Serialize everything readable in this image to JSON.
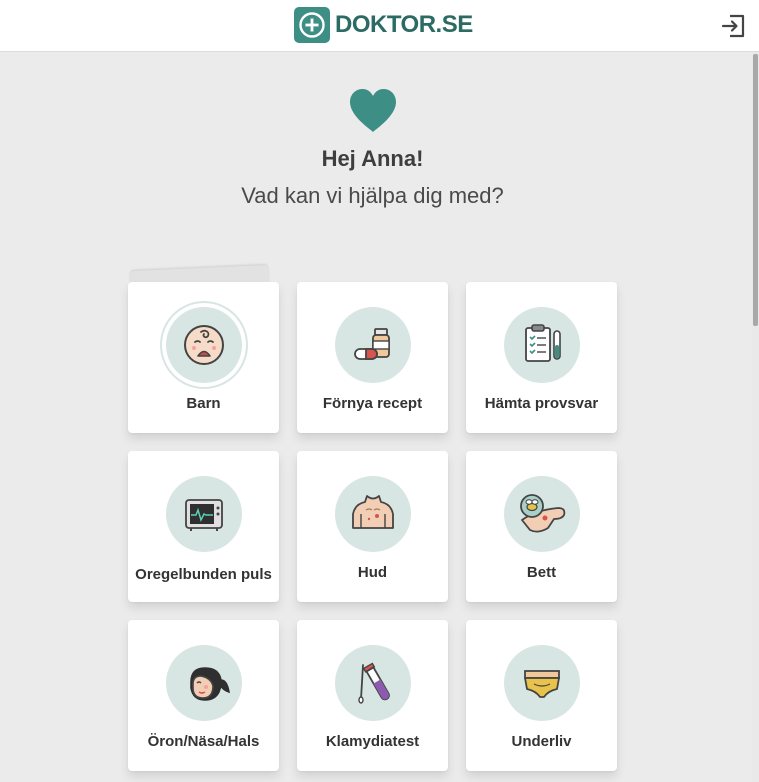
{
  "header": {
    "brand": "DOKTOR.SE",
    "logout_icon": "logout-icon"
  },
  "welcome": {
    "icon": "heart-icon",
    "greeting": "Hej Anna!",
    "question": "Vad kan vi hjälpa dig med?"
  },
  "colors": {
    "brand": "#3d8e84",
    "brand_text": "#2b6b63",
    "icon_circle": "#d8e6e3",
    "background": "#ebebeb"
  },
  "services": [
    {
      "label": "Barn",
      "icon": "baby-icon"
    },
    {
      "label": "Förnya recept",
      "icon": "prescription-icon"
    },
    {
      "label": "Hämta provsvar",
      "icon": "clipboard-test-icon"
    },
    {
      "label": "Oregelbunden puls",
      "icon": "heart-monitor-icon"
    },
    {
      "label": "Hud",
      "icon": "skin-icon"
    },
    {
      "label": "Bett",
      "icon": "insect-bite-icon"
    },
    {
      "label": "Öron/Näsa/Hals",
      "icon": "ent-icon"
    },
    {
      "label": "Klamydiatest",
      "icon": "test-tube-icon"
    },
    {
      "label": "Underliv",
      "icon": "underwear-icon"
    }
  ]
}
